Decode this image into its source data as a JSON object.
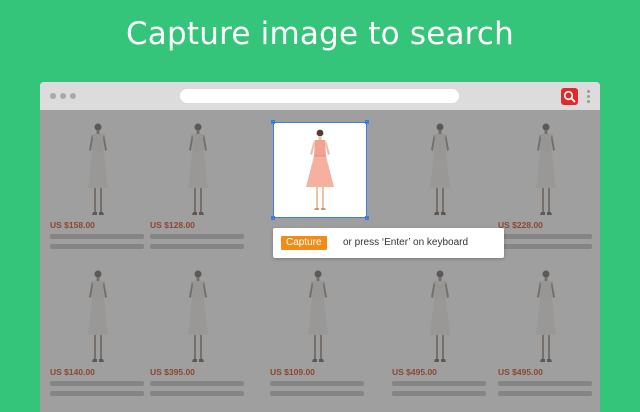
{
  "headline": "Capture image to search",
  "browser": {
    "extension_icon": "search-icon",
    "menu_icon": "more-vertical-icon"
  },
  "products": [
    {
      "price": "US $158.00"
    },
    {
      "price": "US $128.00"
    },
    {
      "price": ""
    },
    {
      "price": ""
    },
    {
      "price": "US $228.00"
    },
    {
      "price": "US $140.00"
    },
    {
      "price": "US $395.00"
    },
    {
      "price": "US $109.00"
    },
    {
      "price": "US $495.00"
    },
    {
      "price": "US $495.00"
    }
  ],
  "capture_tooltip": {
    "button_label": "Capture",
    "hint": "or press ‘Enter’ on keyboard"
  },
  "colors": {
    "background": "#35c57a",
    "accent": "#f08c17",
    "price": "#d4481c",
    "selection": "#3a7ee0",
    "extension": "#e02a2a"
  }
}
